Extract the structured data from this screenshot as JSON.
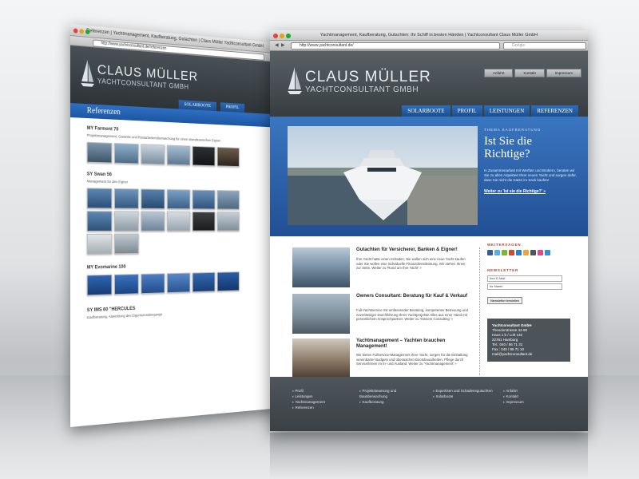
{
  "back": {
    "window_title": "Referenzen | Yachtmanagement, Kaufberatung, Gutachten | Claus Müller Yachtconsultant GmbH",
    "url": "http://www.yachtconsultant.de/referenzen",
    "logo_line1": "CLAUS MÜLLER",
    "logo_line2": "YACHTCONSULTANT GMBH",
    "nav": [
      "SOLARBOOTE",
      "PROFIL"
    ],
    "band_title": "Referenzen",
    "sections": [
      {
        "title": "MY Farmont 70",
        "sub": "Projektmanagement, Garantie und Restarbeitenüberwachung für einen skandinavischen Eigner"
      },
      {
        "title": "SY Swan 56",
        "sub": "Management für den Eigner"
      },
      {
        "title": "MY Evomarine 100",
        "sub": ""
      },
      {
        "title": "SY IMS 60 \"HERCULES",
        "sub": "Kaufberatung, Abwicklung des Eigentumsübergangs"
      }
    ]
  },
  "front": {
    "window_title": "Yachtmanagement, Kaufberatung, Gutachten: Ihr Schiff in besten Händen | Yachtconsultant Claus Müller GmbH",
    "url": "http://www.yachtconsultant.de/",
    "search_placeholder": "Google",
    "topnav": [
      "Anfahrt",
      "Kontakt",
      "Impressum"
    ],
    "logo_line1": "CLAUS MÜLLER",
    "logo_line2": "YACHTCONSULTANT GMBH",
    "nav": [
      "SOLARBOOTE",
      "PROFIL",
      "LEISTUNGEN",
      "REFERENZEN"
    ],
    "hero": {
      "kicker": "THEMA KAUFBERATUNG",
      "title": "Ist Sie die Richtige?",
      "body": "In Zusammenarbeit mit Werften und Brokern, beraten wir Sie zu allen Aspekten Ihrer neuen Yacht und sorgen dafür, dass Sie nicht die Katze im Sack kaufen!",
      "link": "Weiter zu 'Ist sie die Richtige?' »"
    },
    "articles": [
      {
        "title": "Gutachten für Versicherer, Banken & Eigner!",
        "body": "Ihre Yacht hatte einen Schaden, Sie wollen sich eine neue Yacht kaufen oder Sie wollen eine individuelle Finanzdienstleistung. Wir stehen Ihnen zur Seite. Weiter zu 'Rund um Ihre Yacht' »"
      },
      {
        "title": "Owners Consultant: Beratung für Kauf & Verkauf",
        "body": "Full-Yachtservice mit umfassender Beratung, kompetenter Betreuung und zuverlässiger Durchführung Ihres Yachtprojekts! Alles aus einer Hand mit persönlichem Ansprechpartner. Weiter zu 'Owners Consulting' »"
      },
      {
        "title": "Yachtmanagement – Yachten brauchen Management!",
        "body": "Wir bieten Fullservice-Management Ihrer Yacht, sorgen für die Einhaltung vereinbarter Budgets und überwachen Bootsbauarbeiten, Pflege durch Servicefirmen im In- und Ausland. Weiter zu 'Yachtmanagement' »"
      }
    ],
    "copyright": "© YACHTCONSULTANT GmbH | Internetagentur: werk13 Berlin",
    "sidebar": {
      "share_head": "WEITERSAGEN",
      "newsletter_head": "NEWSLETTER",
      "email_placeholder": "Ihre E-Mail",
      "name_placeholder": "Ihr Name",
      "subscribe_label": "Newsletter bestellen",
      "address": [
        "Yachtconsultant GmbH",
        "Theodorstrasse 42-90",
        "Haus 1 b / Loft 132",
        "22761 Hamburg",
        "Tel.: 040 / 86 71 31",
        "Fax.: 040 / 86 71 10",
        "mail@yachtconsultant.de"
      ]
    },
    "footer": [
      [
        "Profil",
        "Leistungen",
        "Yachtmanagement",
        "Referenzen"
      ],
      [
        "Projektsteuerung und Bauüberwachung",
        "Kaufberatung"
      ],
      [
        "Expertisen und Schadensgutachten",
        "Solarboote"
      ],
      [
        "Anfahrt",
        "Kontakt",
        "Impressum"
      ]
    ]
  }
}
